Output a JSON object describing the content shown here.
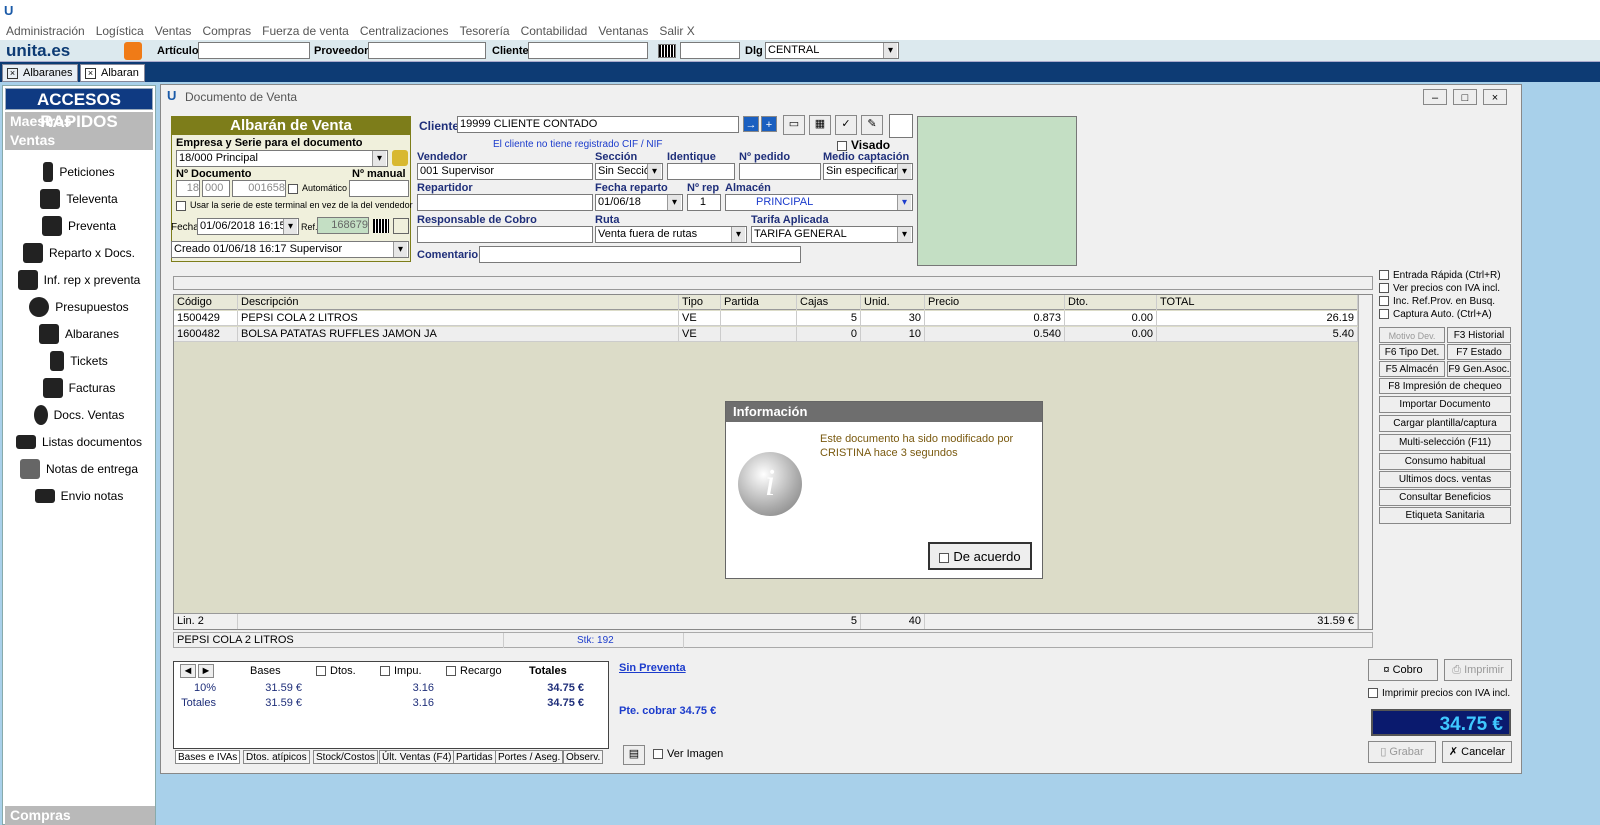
{
  "menu": [
    "Administración",
    "Logística",
    "Ventas",
    "Compras",
    "Fuerza de venta",
    "Centralizaciones",
    "Tesorería",
    "Contabilidad",
    "Ventanas",
    "Salir X"
  ],
  "toolbar": {
    "logo": "unita.es",
    "articulo_label": "Artículo",
    "proveedor_label": "Proveedor",
    "cliente_label": "Cliente",
    "dlg_label": "Dlg",
    "dlg_value": "CENTRAL"
  },
  "tabs": [
    "Albaranes",
    "Albaran"
  ],
  "sidebar": {
    "title": "ACCESOS RAPIDOS",
    "groups": [
      "Maestros",
      "Ventas"
    ],
    "items": [
      "Peticiones",
      "Televenta",
      "Preventa",
      "Reparto x Docs.",
      "Inf. rep x preventa",
      "Presupuestos",
      "Albaranes",
      "Tickets",
      "Facturas",
      "Docs. Ventas",
      "Listas documentos",
      "Notas de entrega",
      "Envio notas"
    ],
    "bottom": "Compras"
  },
  "doc": {
    "title": "Documento de Venta",
    "panel_title": "Albarán de Venta",
    "empresa_label": "Empresa y Serie para el documento",
    "empresa_value": "18/000 Principal",
    "ndoc_label": "Nº Documento",
    "ndoc1": "18",
    "ndoc2": "000",
    "ndoc3": "001658",
    "auto_label": "Automático",
    "nmanual_label": "Nº manual",
    "serie_label": "Usar la serie de este terminal en vez de la del vendedor",
    "fecha_label": "Fecha",
    "fecha_value": "01/06/2018 16:15",
    "ref_label": "Ref.",
    "ref_value": "168679",
    "creado": "Creado 01/06/18 16:17 Supervisor",
    "cliente_label": "Cliente",
    "cliente_value": "19999 CLIENTE CONTADO",
    "cif_warning": "El cliente no tiene registrado CIF / NIF",
    "visado_label": "Visado",
    "vendedor_label": "Vendedor",
    "vendedor_value": "001 Supervisor",
    "seccion_label": "Sección",
    "seccion_value": "Sin Sección",
    "identique_label": "Identique",
    "npedido_label": "Nº pedido",
    "medio_label": "Medio captación",
    "medio_value": "Sin especificar",
    "repartidor_label": "Repartidor",
    "fechareparto_label": "Fecha reparto",
    "fechareparto_value": "01/06/18",
    "nrep_label": "Nº rep",
    "nrep_value": "1",
    "almacen_label": "Almacén",
    "almacen_value": "PRINCIPAL",
    "resp_label": "Responsable de Cobro",
    "ruta_label": "Ruta",
    "ruta_value": "Venta fuera de rutas",
    "tarifa_label": "Tarifa Aplicada",
    "tarifa_value": "TARIFA GENERAL",
    "comentario_label": "Comentario"
  },
  "grid": {
    "headers": [
      "Código",
      "Descripción",
      "Tipo",
      "Partida",
      "Cajas",
      "Unid.",
      "Precio",
      "Dto.",
      "TOTAL"
    ],
    "rows": [
      [
        "1500429",
        "PEPSI COLA 2 LITROS",
        "VE",
        "",
        "5",
        "30",
        "0.873",
        "0.00",
        "26.19"
      ],
      [
        "1600482",
        "BOLSA PATATAS RUFFLES JAMON JA",
        "VE",
        "",
        "0",
        "10",
        "0.540",
        "0.00",
        "5.40"
      ]
    ],
    "footer": {
      "lin": "Lin. 2",
      "cajas": "5",
      "unid": "40",
      "total": "31.59 €"
    },
    "status_desc": "PEPSI COLA 2 LITROS",
    "stk": "Stk: 192"
  },
  "options": [
    "Entrada Rápida (Ctrl+R)",
    "Ver precios con IVA incl.",
    "Inc. Ref.Prov. en Busq.",
    "Captura Auto. (Ctrl+A)"
  ],
  "actions": {
    "motivo": "Motivo Dev.",
    "historial": "F3 Historial",
    "tipodet": "F6 Tipo Det.",
    "estado": "F7 Estado",
    "almacen": "F5 Almacén",
    "genasoc": "F9 Gen.Asoc.",
    "cheque": "F8 Impresión de chequeo",
    "list": [
      "Importar Documento",
      "Cargar plantilla/captura",
      "Multi-selección (F11)",
      "Consumo habitual",
      "Ultimos docs. ventas",
      "Consultar Beneficios",
      "Etiqueta Sanitaria"
    ]
  },
  "dialog": {
    "title": "Información",
    "message1": "Este documento ha sido modificado por",
    "message2": "CRISTINA hace 3 segundos",
    "button": "De acuerdo"
  },
  "totals": {
    "headers": [
      "Bases",
      "Dtos.",
      "Impu.",
      "Recargo",
      "Totales"
    ],
    "row1": [
      "10%",
      "31.59 €",
      "",
      "3.16",
      "",
      "34.75 €"
    ],
    "row2": [
      "Totales",
      "31.59 €",
      "",
      "3.16",
      "",
      "34.75 €"
    ],
    "tabs": [
      "Bases e IVAs",
      "Dtos. atípicos",
      "Stock/Costos",
      "Últ. Ventas (F4)",
      "Partidas",
      "Portes / Aseg.",
      "Observ."
    ]
  },
  "footer": {
    "sin_preventa": "Sin Preventa",
    "pte_cobrar": "Pte. cobrar 34.75 €",
    "ver_imagen": "Ver Imagen",
    "cobro": "Cobro",
    "imprimir": "Imprimir",
    "imp_iva": "Imprimir precios con IVA incl.",
    "total": "34.75 €",
    "grabar": "Grabar",
    "cancelar": "Cancelar"
  },
  "colors": {
    "navy": "#0d3b74",
    "green_panel": "#c4dfc4",
    "olive": "#7d7d1a",
    "total_bg": "#0a1a6e",
    "total_fg": "#3fc8ff"
  }
}
